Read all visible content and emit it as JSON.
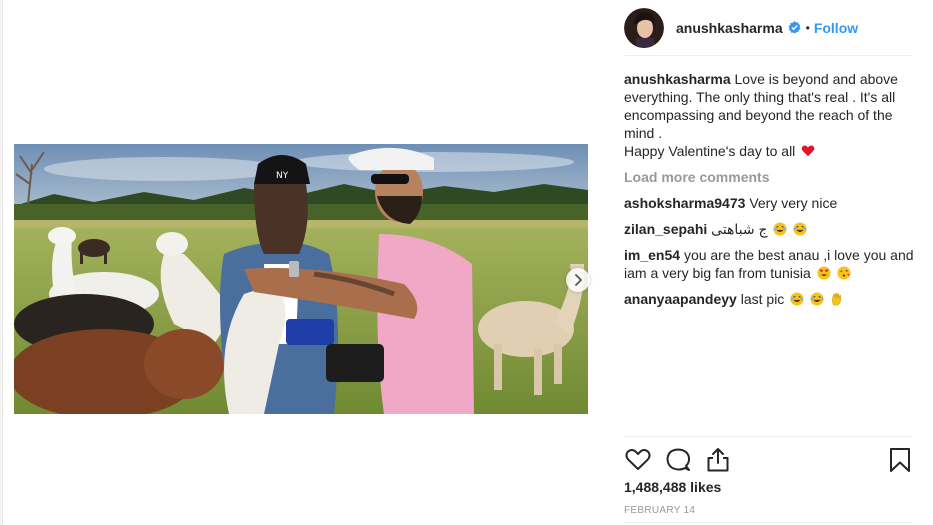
{
  "post": {
    "author": "anushkasharma",
    "follow_label": "Follow",
    "dot": "•",
    "caption_line1": "Love is beyond and above everything. The only thing that's real . It's all encompassing and beyond the reach of the mind .",
    "caption_line2": "Happy Valentine's day to all",
    "load_more": "Load more comments",
    "likes": "1,488,488 likes",
    "date": "FEBRUARY 14"
  },
  "comments": [
    {
      "user": "ashoksharma9473",
      "text": "Very very nice"
    },
    {
      "user": "zilan_sepahi",
      "text": "ج شباهتی"
    },
    {
      "user": "im_en54",
      "text": "you are the best anau ,i love you and iam a very big fan from tunisia"
    },
    {
      "user": "ananyaapandeyy",
      "text": "last pic"
    }
  ],
  "icons": {
    "verified": "verified-badge-icon",
    "heart": "heart-icon",
    "laugh": "laughing-tears-emoji",
    "heart_eyes": "heart-eyes-emoji",
    "kiss": "blowing-kiss-emoji",
    "hand": "raised-hand-emoji",
    "like": "like-heart-icon",
    "comment": "comment-bubble-icon",
    "share": "share-icon",
    "bookmark": "bookmark-icon",
    "next": "chevron-right-icon"
  },
  "colors": {
    "link_blue": "#3897f0",
    "text": "#262626",
    "muted": "#999999",
    "heart_red": "#ed4956",
    "emoji_yellow": "#f7c21b"
  }
}
